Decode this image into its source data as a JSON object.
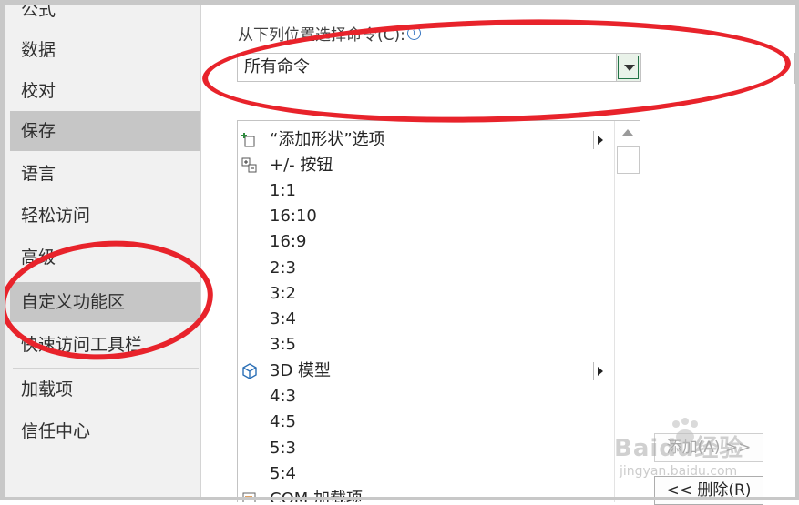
{
  "sidebar": {
    "items": [
      {
        "label": "公式",
        "selected": false
      },
      {
        "label": "数据",
        "selected": false
      },
      {
        "label": "校对",
        "selected": false
      },
      {
        "label": "保存",
        "selected": true
      },
      {
        "label": "语言",
        "selected": false
      },
      {
        "label": "轻松访问",
        "selected": false
      },
      {
        "label": "高级",
        "selected": false
      },
      {
        "label": "自定义功能区",
        "selected": true
      },
      {
        "label": "快速访问工具栏",
        "selected": false
      },
      {
        "label": "加载项",
        "selected": false
      },
      {
        "label": "信任中心",
        "selected": false
      }
    ]
  },
  "commands": {
    "label": "从下列位置选择命令(C):",
    "info_icon": "i",
    "selected_source": "所有命令"
  },
  "command_list": {
    "items": [
      {
        "label": "“添加形状”选项",
        "icon": "add-shape-icon",
        "submenu": true
      },
      {
        "label": "+/- 按钮",
        "icon": "expand-collapse-icon",
        "submenu": false
      },
      {
        "label": "1:1",
        "icon": "",
        "submenu": false
      },
      {
        "label": "16:10",
        "icon": "",
        "submenu": false
      },
      {
        "label": "16:9",
        "icon": "",
        "submenu": false
      },
      {
        "label": "2:3",
        "icon": "",
        "submenu": false
      },
      {
        "label": "3:2",
        "icon": "",
        "submenu": false
      },
      {
        "label": "3:4",
        "icon": "",
        "submenu": false
      },
      {
        "label": "3:5",
        "icon": "",
        "submenu": false
      },
      {
        "label": "3D 模型",
        "icon": "3d-model-icon",
        "submenu": true
      },
      {
        "label": "4:3",
        "icon": "",
        "submenu": false
      },
      {
        "label": "4:5",
        "icon": "",
        "submenu": false
      },
      {
        "label": "5:3",
        "icon": "",
        "submenu": false
      },
      {
        "label": "5:4",
        "icon": "",
        "submenu": false
      },
      {
        "label": "COM 加载项",
        "icon": "com-addin-icon",
        "submenu": false
      }
    ]
  },
  "buttons": {
    "add": "添加(A) >>",
    "remove": "<< 删除(R)"
  },
  "watermark": {
    "brand": "Baidu经验",
    "url": "jingyan.baidu.com"
  },
  "colors": {
    "accent_green": "#217346",
    "annotation_red": "#e8232b",
    "selected_bg": "#c6c6c6"
  }
}
